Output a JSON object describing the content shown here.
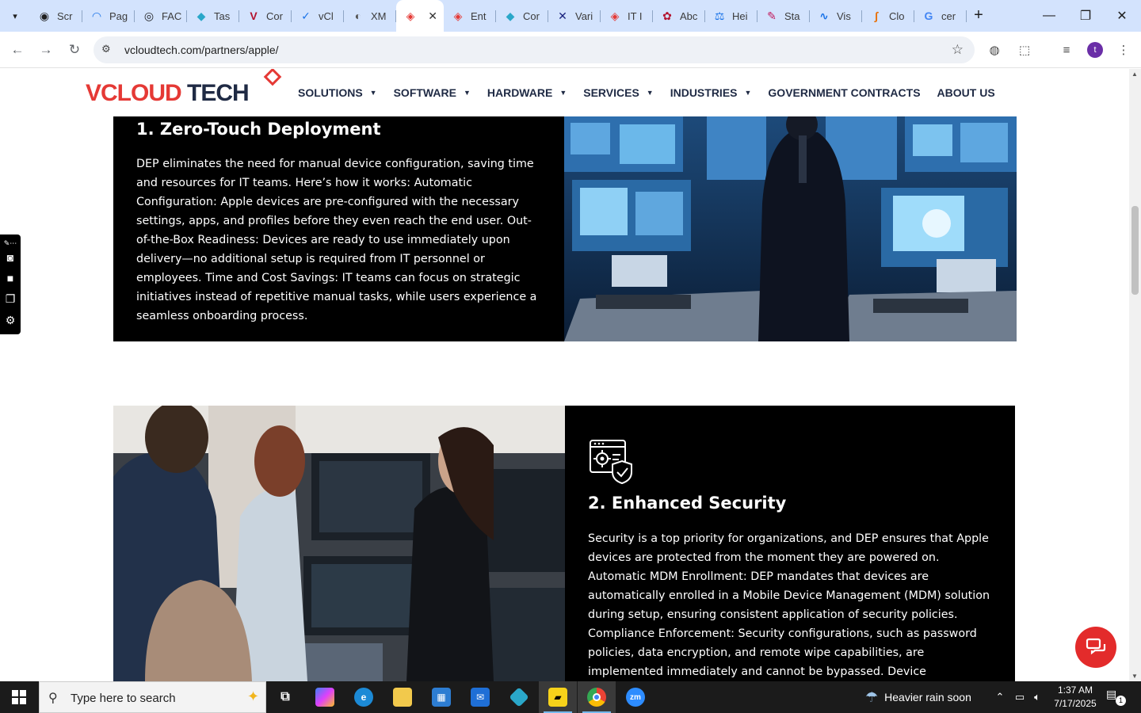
{
  "browser": {
    "tabs": [
      {
        "label": "Scr",
        "color": "#1f1f1f",
        "glyph": "◉"
      },
      {
        "label": "Pag",
        "color": "#1a73e8",
        "glyph": "◠"
      },
      {
        "label": "FAC",
        "color": "#202124",
        "glyph": "◎"
      },
      {
        "label": "Tas",
        "color": "#2aa7c9",
        "glyph": "◆"
      },
      {
        "label": "Cor",
        "color": "#b3122e",
        "glyph": "V"
      },
      {
        "label": "vCl",
        "color": "#1a73e8",
        "glyph": "✓"
      },
      {
        "label": "XM",
        "color": "#555555",
        "glyph": "◐"
      },
      {
        "label": "",
        "color": "#e53935",
        "glyph": "◈",
        "active": true
      },
      {
        "label": "Ent",
        "color": "#e53935",
        "glyph": "◈"
      },
      {
        "label": "Cor",
        "color": "#2aa7c9",
        "glyph": "◆"
      },
      {
        "label": "Vari",
        "color": "#1a237e",
        "glyph": "✕"
      },
      {
        "label": "IT I",
        "color": "#e53935",
        "glyph": "◈"
      },
      {
        "label": "Abc",
        "color": "#b3122e",
        "glyph": "✿"
      },
      {
        "label": "Hei",
        "color": "#1a73e8",
        "glyph": "⚖"
      },
      {
        "label": "Sta",
        "color": "#c2185b",
        "glyph": "✎"
      },
      {
        "label": "Vis",
        "color": "#1a73e8",
        "glyph": "∿"
      },
      {
        "label": "Clo",
        "color": "#e8710a",
        "glyph": "∫"
      },
      {
        "label": "cer",
        "color": "#4285f4",
        "glyph": "G"
      }
    ],
    "url": "vcloudtech.com/partners/apple/",
    "profile_initial": "t"
  },
  "site": {
    "logo_part1": "VCLOUD",
    "logo_part2": "TECH",
    "menu": [
      {
        "label": "SOLUTIONS",
        "has_dropdown": true
      },
      {
        "label": "SOFTWARE",
        "has_dropdown": true
      },
      {
        "label": "HARDWARE",
        "has_dropdown": true
      },
      {
        "label": "SERVICES",
        "has_dropdown": true
      },
      {
        "label": "INDUSTRIES",
        "has_dropdown": true
      },
      {
        "label": "GOVERNMENT CONTRACTS",
        "has_dropdown": false
      },
      {
        "label": "ABOUT US",
        "has_dropdown": false
      }
    ]
  },
  "sections": [
    {
      "title": "1. Zero-Touch Deployment",
      "body": "DEP eliminates the need for manual device configuration, saving time and resources for IT teams. Here’s how it works: Automatic Configuration: Apple devices are pre-configured with the necessary settings, apps, and profiles before they even reach the end user. Out-of-the-Box Readiness: Devices are ready to use immediately upon delivery—no additional setup is required from IT personnel or employees. Time and Cost Savings: IT teams can focus on strategic initiatives instead of repetitive manual tasks, while users experience a seamless onboarding process."
    },
    {
      "title": "2. Enhanced Security",
      "body": "Security is a top priority for organizations, and DEP ensures that Apple devices are protected from the moment they are powered on. Automatic MDM Enrollment: DEP mandates that devices are automatically enrolled in a Mobile Device Management (MDM) solution during setup, ensuring consistent application of security policies. Compliance Enforcement: Security configurations, such as password policies, data encryption, and remote wipe capabilities, are implemented immediately and cannot be bypassed. Device"
    }
  ],
  "taskbar": {
    "search_placeholder": "Type here to search",
    "weather": "Heavier rain soon",
    "time": "1:37 AM",
    "date": "7/17/2025",
    "notification_count": "1"
  }
}
